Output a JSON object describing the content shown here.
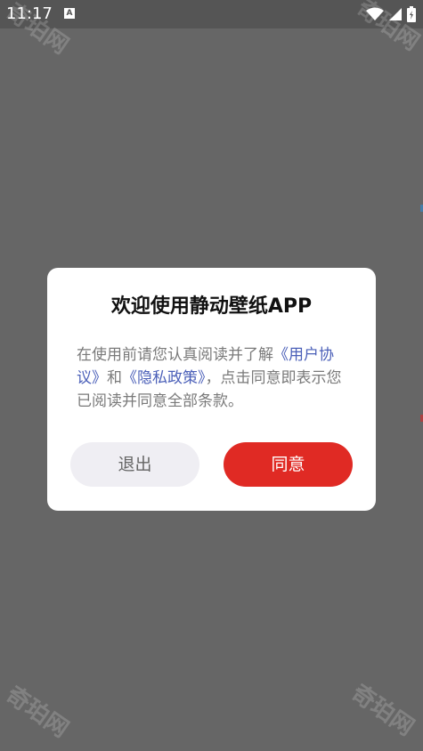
{
  "status_bar": {
    "time": "11:17",
    "notification_icon": "a-letter-icon",
    "icons": [
      "wifi-icon",
      "signal-icon",
      "battery-icon"
    ]
  },
  "watermark": {
    "text": "奇珀网"
  },
  "dialog": {
    "title": "欢迎使用静动壁纸APP",
    "body_prefix": "在使用前请您认真阅读并了解",
    "user_agreement_link": "《用户协议》",
    "conjunction": "和",
    "privacy_policy_link": "《隐私政策》",
    "body_suffix": "，点击同意即表示您已阅读并同意全部条款。",
    "exit_button": "退出",
    "agree_button": "同意"
  },
  "colors": {
    "overlay": "#666666",
    "status_bar": "#555555",
    "link": "#4a5fb8",
    "agree_button": "#e02a24",
    "exit_button": "#efeef3"
  }
}
